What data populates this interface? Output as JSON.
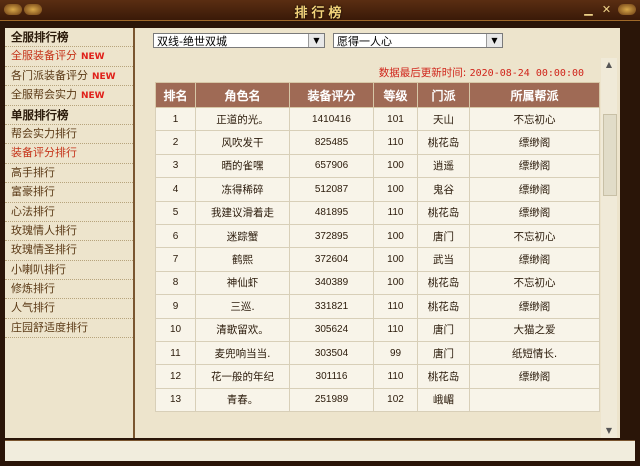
{
  "window": {
    "title": "排行榜"
  },
  "sidebar": {
    "items": [
      {
        "label": "全服排行榜",
        "type": "header"
      },
      {
        "label": "全服装备评分",
        "type": "sub",
        "new": "NEW"
      },
      {
        "label": "各门派装备评分",
        "type": "normal",
        "new": "NEW"
      },
      {
        "label": "全服帮会实力",
        "type": "normal",
        "new": "NEW"
      },
      {
        "label": "单服排行榜",
        "type": "header"
      },
      {
        "label": "帮会实力排行",
        "type": "normal"
      },
      {
        "label": "装备评分排行",
        "type": "active"
      },
      {
        "label": "高手排行",
        "type": "normal"
      },
      {
        "label": "富豪排行",
        "type": "normal"
      },
      {
        "label": "心法排行",
        "type": "normal"
      },
      {
        "label": "玫瑰情人排行",
        "type": "normal"
      },
      {
        "label": "玫瑰情圣排行",
        "type": "normal"
      },
      {
        "label": "小喇叭排行",
        "type": "normal"
      },
      {
        "label": "修炼排行",
        "type": "normal"
      },
      {
        "label": "人气排行",
        "type": "normal"
      },
      {
        "label": "庄园舒适度排行",
        "type": "normal"
      }
    ]
  },
  "filters": {
    "server": "双线-绝世双城",
    "world": "愿得一人心"
  },
  "update": {
    "label": "数据最后更新时间:",
    "time": "2020-08-24 00:00:00"
  },
  "table": {
    "headers": [
      "排名",
      "角色名",
      "装备评分",
      "等级",
      "门派",
      "所属帮派"
    ],
    "rows": [
      [
        "1",
        "正道的光。",
        "1410416",
        "101",
        "天山",
        "不忘初心"
      ],
      [
        "2",
        "风吹发干",
        "825485",
        "110",
        "桃花岛",
        "缥缈阁"
      ],
      [
        "3",
        "晒的雀嘿",
        "657906",
        "100",
        "逍遥",
        "缥缈阁"
      ],
      [
        "4",
        "冻得稀碎",
        "512087",
        "100",
        "鬼谷",
        "缥缈阁"
      ],
      [
        "5",
        "我建议滑着走",
        "481895",
        "110",
        "桃花岛",
        "缥缈阁"
      ],
      [
        "6",
        "迷踪蟹",
        "372895",
        "100",
        "唐门",
        "不忘初心"
      ],
      [
        "7",
        "鹤熙",
        "372604",
        "100",
        "武当",
        "缥缈阁"
      ],
      [
        "8",
        "神仙虾",
        "340389",
        "100",
        "桃花岛",
        "不忘初心"
      ],
      [
        "9",
        "三巡.",
        "331821",
        "110",
        "桃花岛",
        "缥缈阁"
      ],
      [
        "10",
        "清歌留欢。",
        "305624",
        "110",
        "唐门",
        "大猫之爱"
      ],
      [
        "11",
        "麦兜响当当.",
        "303504",
        "99",
        "唐门",
        "纸短情长."
      ],
      [
        "12",
        "花一般的年纪",
        "301116",
        "110",
        "桃花岛",
        "缥缈阁"
      ],
      [
        "13",
        "青春。",
        "251989",
        "102",
        "峨嵋",
        ""
      ]
    ]
  },
  "icons": {
    "select_arrow": "chevron-down-icon",
    "scroll_up": "arrow-up-icon",
    "scroll_down": "arrow-down-icon",
    "minimize": "minimize-icon",
    "close": "close-icon"
  }
}
